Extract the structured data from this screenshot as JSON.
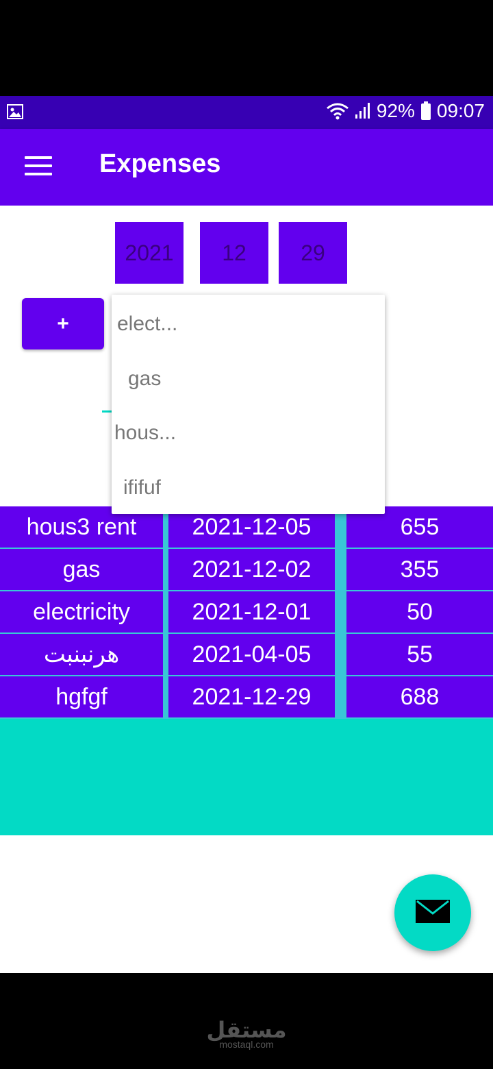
{
  "status_bar": {
    "battery": "92%",
    "time": "09:07"
  },
  "app_bar": {
    "title": "Expenses"
  },
  "date_picker": {
    "year": "2021",
    "month": "12",
    "day": "29"
  },
  "add_button": {
    "label": "+"
  },
  "dropdown": {
    "items": [
      "elect...",
      "gas",
      "hous...",
      "ififuf"
    ]
  },
  "table": {
    "rows": [
      {
        "name": "hous3 rent",
        "date": "2021-12-05",
        "amount": "655"
      },
      {
        "name": "gas",
        "date": "2021-12-02",
        "amount": "355"
      },
      {
        "name": "electricity",
        "date": "2021-12-01",
        "amount": "50"
      },
      {
        "name": "هرنبنبت",
        "date": "2021-04-05",
        "amount": "55"
      },
      {
        "name": "hgfgf",
        "date": "2021-12-29",
        "amount": "688"
      }
    ]
  },
  "watermark": {
    "arabic": "مستقل",
    "latin": "mostaql.com"
  },
  "colors": {
    "primary": "#6200ee",
    "primary_dark": "#3700b3",
    "accent": "#03dac5"
  },
  "icons": {
    "status_left": "image-icon",
    "wifi": "wifi-icon",
    "signal": "signal-icon",
    "battery": "battery-icon",
    "menu": "menu-icon",
    "fab": "email-icon"
  }
}
